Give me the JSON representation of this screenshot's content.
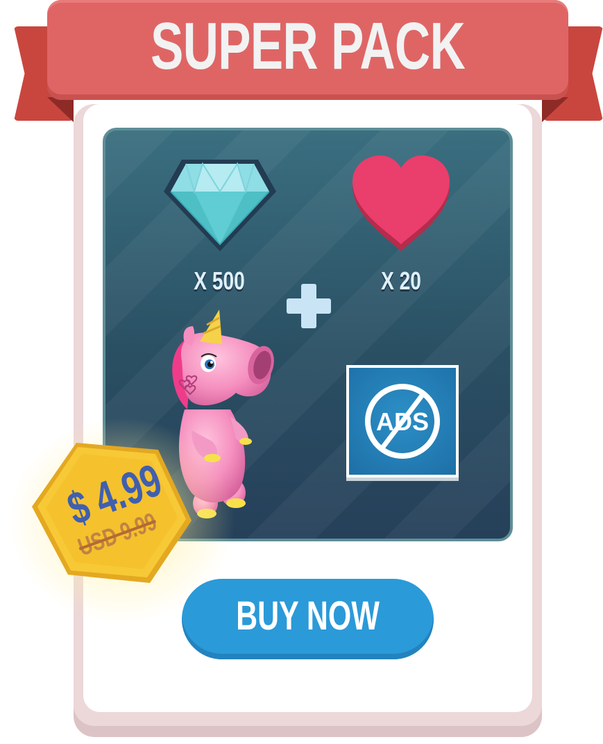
{
  "pack": {
    "title": "SUPER PACK"
  },
  "items": {
    "gems": {
      "label": "X 500",
      "icon": "diamond-icon",
      "color": "#4cc3c8"
    },
    "lives": {
      "label": "X 20",
      "icon": "heart-icon",
      "color": "#e33d6a"
    },
    "bonus_icon": "plus-icon",
    "character": {
      "icon": "pink-unicorn-character"
    },
    "no_ads": {
      "text": "ADS",
      "icon": "no-ads-icon"
    }
  },
  "price": {
    "current": "$ 4.99",
    "original": "USD 9.99"
  },
  "buy_button": {
    "label": "BUY NOW",
    "color": "#2b9ad8"
  },
  "colors": {
    "ribbon": "#df6565",
    "panel": "#2a4f63",
    "price_tag": "#f5c530",
    "price_text": "#3f5fb0"
  }
}
